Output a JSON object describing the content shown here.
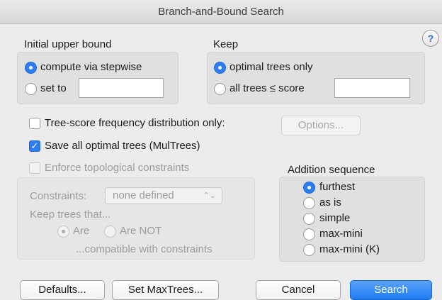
{
  "window": {
    "title": "Branch-and-Bound Search"
  },
  "help": {
    "label": "?"
  },
  "upper_bound": {
    "heading": "Initial upper bound",
    "opt_stepwise": "compute via stepwise",
    "opt_setto": "set to",
    "setto_value": ""
  },
  "keep": {
    "heading": "Keep",
    "opt_optimal": "optimal trees only",
    "opt_all": "all trees ≤ score",
    "score_value": ""
  },
  "options": {
    "freq_dist": "Tree-score frequency distribution only:",
    "options_button": "Options...",
    "save_optimal": "Save all optimal trees (MulTrees)",
    "enforce": "Enforce topological constraints",
    "check_mark": "✓"
  },
  "constraints": {
    "label": "Constraints:",
    "select_value": "none defined",
    "select_arrows": "⌃⌄",
    "keep_that": "Keep trees that...",
    "opt_are": "Are",
    "opt_are_not": "Are NOT",
    "compatible": "...compatible with constraints"
  },
  "addition": {
    "heading": "Addition sequence",
    "items": [
      "furthest",
      "as is",
      "simple",
      "max-mini",
      "max-mini (K)"
    ]
  },
  "buttons": {
    "defaults": "Defaults...",
    "set_maxtrees": "Set MaxTrees...",
    "cancel": "Cancel",
    "search": "Search"
  }
}
